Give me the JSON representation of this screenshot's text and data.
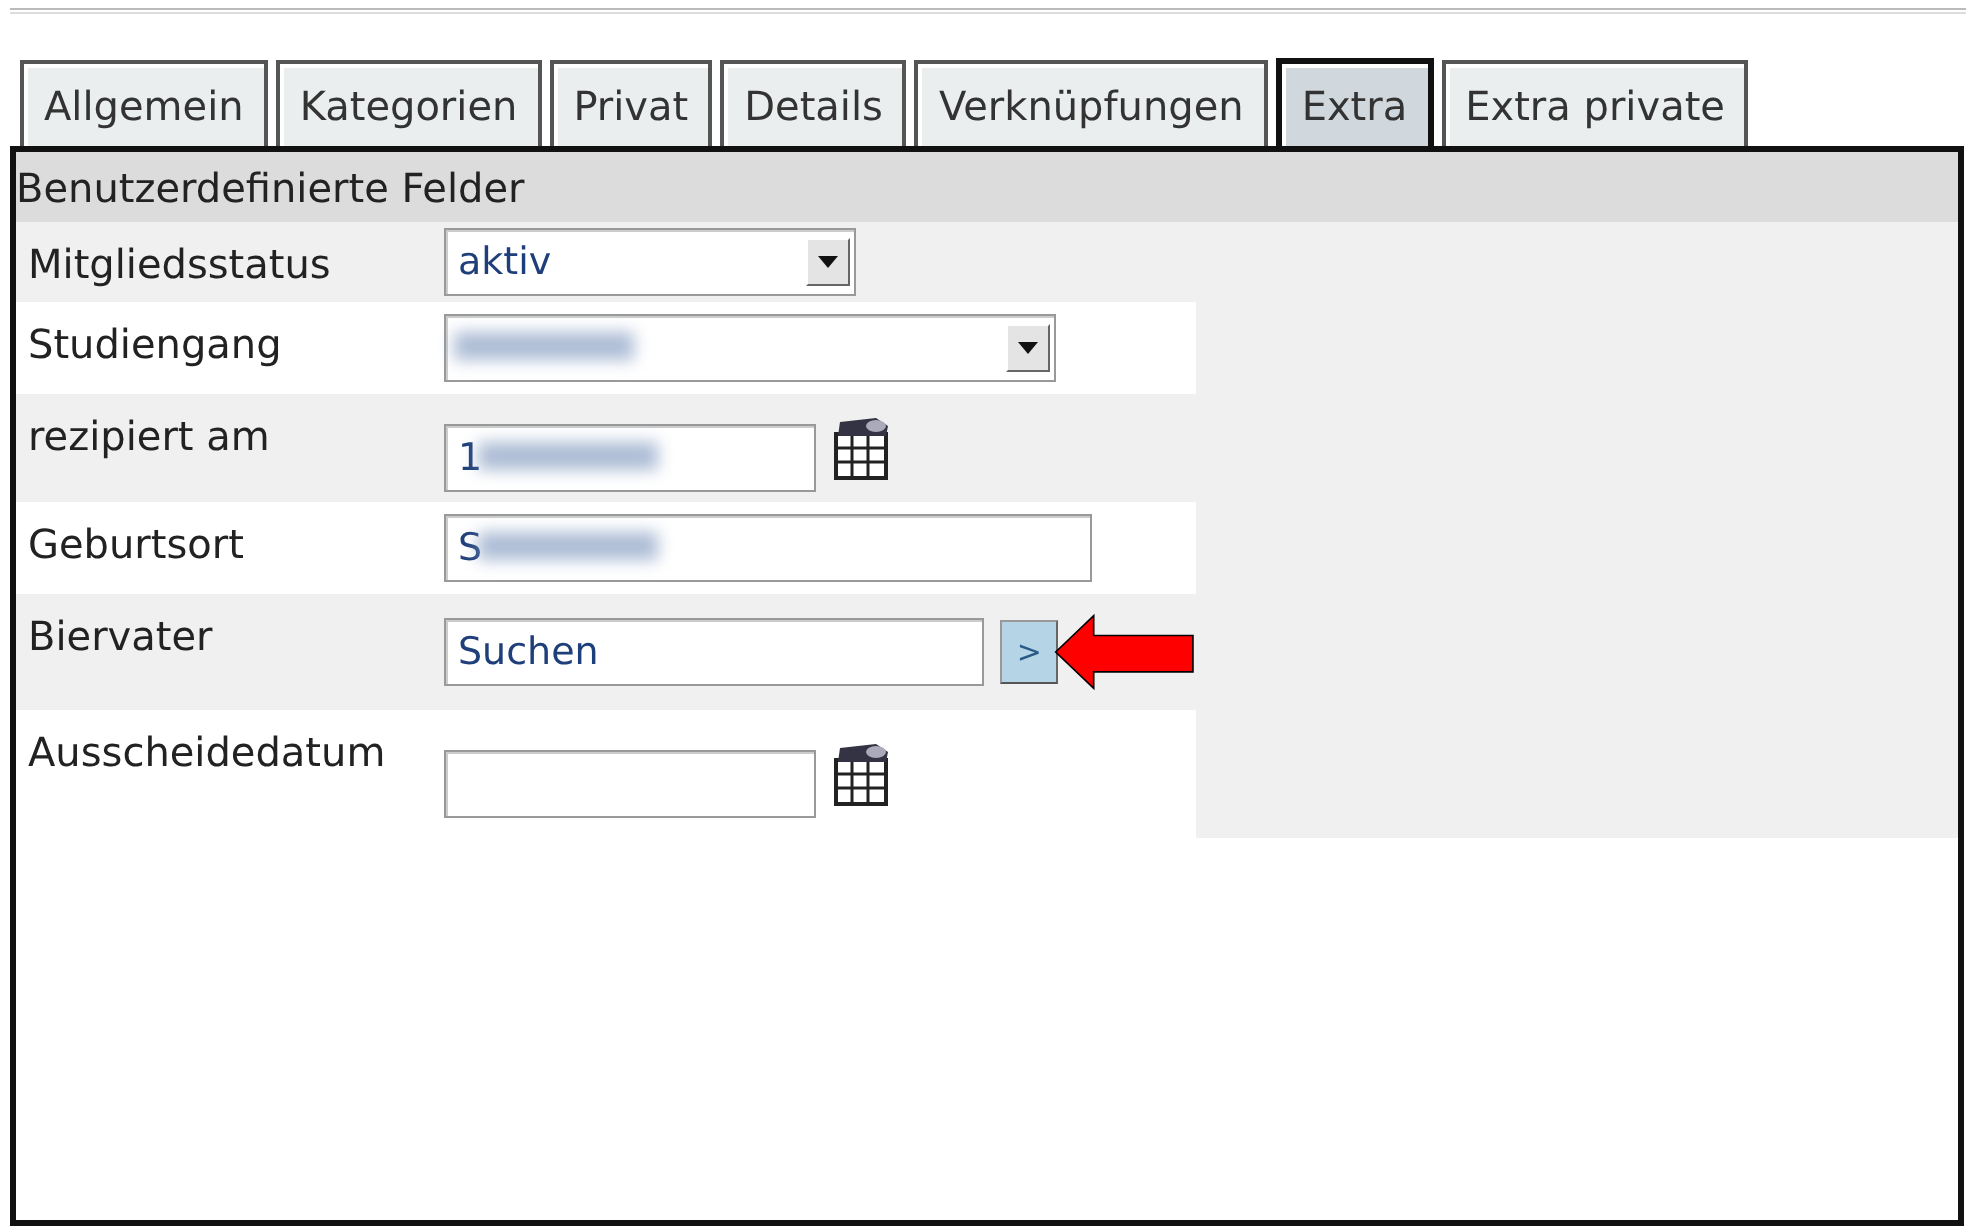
{
  "tabs": [
    {
      "label": "Allgemein",
      "selected": false
    },
    {
      "label": "Kategorien",
      "selected": false
    },
    {
      "label": "Privat",
      "selected": false
    },
    {
      "label": "Details",
      "selected": false
    },
    {
      "label": "Verknüpfungen",
      "selected": false
    },
    {
      "label": "Extra",
      "selected": true
    },
    {
      "label": "Extra private",
      "selected": false
    }
  ],
  "section": {
    "title": "Benutzerdefinierte Felder"
  },
  "fields": [
    {
      "label": "Mitgliedsstatus",
      "kind": "select",
      "value": "aktiv"
    },
    {
      "label": "Studiengang",
      "kind": "select",
      "blurred": true
    },
    {
      "label": "rezipiert am",
      "kind": "date",
      "value": "1",
      "blurred": true
    },
    {
      "label": "Geburtsort",
      "kind": "text",
      "value": "S",
      "blurred": true
    },
    {
      "label": "Biervater",
      "kind": "search",
      "value": "Suchen",
      "button": ">",
      "highlighted": true
    },
    {
      "label": "Ausscheidedatum",
      "kind": "date"
    }
  ]
}
